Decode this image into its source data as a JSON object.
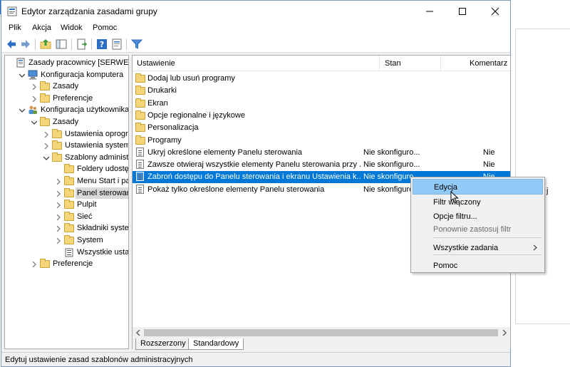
{
  "window": {
    "title": "Edytor zarządzania zasadami grupy"
  },
  "menu": [
    "Plik",
    "Akcja",
    "Widok",
    "Pomoc"
  ],
  "tree": {
    "items": [
      {
        "label": "Zasady pracownicy [SERWER.SC",
        "icon": "policy-icon",
        "level": 0,
        "arrow": "none"
      },
      {
        "label": "Konfiguracja komputera",
        "icon": "computer-icon",
        "level": 1,
        "arrow": "down"
      },
      {
        "label": "Zasady",
        "icon": "folder-icon",
        "level": 2,
        "arrow": "right"
      },
      {
        "label": "Preferencje",
        "icon": "folder-icon",
        "level": 2,
        "arrow": "right"
      },
      {
        "label": "Konfiguracja użytkownika",
        "icon": "users-icon",
        "level": 1,
        "arrow": "down"
      },
      {
        "label": "Zasady",
        "icon": "folder-icon",
        "level": 2,
        "arrow": "down"
      },
      {
        "label": "Ustawienia oprogram",
        "icon": "folder-icon",
        "level": 3,
        "arrow": "right"
      },
      {
        "label": "Ustawienia systemu W",
        "icon": "folder-icon",
        "level": 3,
        "arrow": "right"
      },
      {
        "label": "Szablony administrac",
        "icon": "folder-icon",
        "level": 3,
        "arrow": "down"
      },
      {
        "label": "Foldery udostępn",
        "icon": "folder-icon",
        "level": 4,
        "arrow": "none"
      },
      {
        "label": "Menu Start i pase",
        "icon": "folder-icon",
        "level": 4,
        "arrow": "right"
      },
      {
        "label": "Panel sterowania",
        "icon": "folder-icon",
        "level": 4,
        "arrow": "right",
        "selected": true
      },
      {
        "label": "Pulpit",
        "icon": "folder-icon",
        "level": 4,
        "arrow": "right"
      },
      {
        "label": "Sieć",
        "icon": "folder-icon",
        "level": 4,
        "arrow": "right"
      },
      {
        "label": "Składniki systemu",
        "icon": "folder-icon",
        "level": 4,
        "arrow": "right"
      },
      {
        "label": "System",
        "icon": "folder-icon",
        "level": 4,
        "arrow": "right"
      },
      {
        "label": "Wszystkie ustawie",
        "icon": "settings-list-icon",
        "level": 4,
        "arrow": "none"
      },
      {
        "label": "Preferencje",
        "icon": "folder-icon",
        "level": 2,
        "arrow": "right"
      }
    ]
  },
  "list": {
    "columns": [
      "Ustawienie",
      "Stan",
      "Komentarz"
    ],
    "rows": [
      {
        "name": "Dodaj lub usuń programy",
        "state": "",
        "comment": "",
        "type": "folder"
      },
      {
        "name": "Drukarki",
        "state": "",
        "comment": "",
        "type": "folder"
      },
      {
        "name": "Ekran",
        "state": "",
        "comment": "",
        "type": "folder"
      },
      {
        "name": "Opcje regionalne i językowe",
        "state": "",
        "comment": "",
        "type": "folder"
      },
      {
        "name": "Personalizacja",
        "state": "",
        "comment": "",
        "type": "folder"
      },
      {
        "name": "Programy",
        "state": "",
        "comment": "",
        "type": "folder"
      },
      {
        "name": "Ukryj określone elementy Panelu sterowania",
        "state": "Nie skonfiguro...",
        "comment": "Nie",
        "type": "setting"
      },
      {
        "name": "Zawsze otwieraj wszystkie elementy Panelu sterowania przy ...",
        "state": "Nie skonfiguro...",
        "comment": "Nie",
        "type": "setting"
      },
      {
        "name": "Zabroń dostępu do Panelu sterowania i ekranu Ustawienia k...",
        "state": "Nie skonfiguro...",
        "comment": "Nie",
        "type": "setting",
        "selected": true
      },
      {
        "name": "Pokaż tylko określone elementy Panelu sterowania",
        "state": "Nie skonfiguro",
        "comment": "",
        "type": "setting"
      }
    ]
  },
  "tabs": [
    "Rozszerzony",
    "Standardowy"
  ],
  "active_tab": "Standardowy",
  "status_bar": "Edytuj ustawienie zasad szablonów administracyjnych",
  "context_menu": {
    "items": [
      {
        "label": "Edycja",
        "state": "hover"
      },
      {
        "label": "Filtr włączony",
        "state": "normal"
      },
      {
        "label": "Opcje filtru...",
        "state": "normal"
      },
      {
        "label": "Ponownie zastosuj filtr",
        "state": "disabled"
      },
      {
        "label": "Wszystkie zadania",
        "state": "submenu"
      },
      {
        "label": "Pomoc",
        "state": "normal"
      }
    ]
  },
  "background_window_text": "j",
  "colors": {
    "selection": "#0078d7",
    "menu_hover": "#91c9f7",
    "folder": "#f5d57a"
  }
}
